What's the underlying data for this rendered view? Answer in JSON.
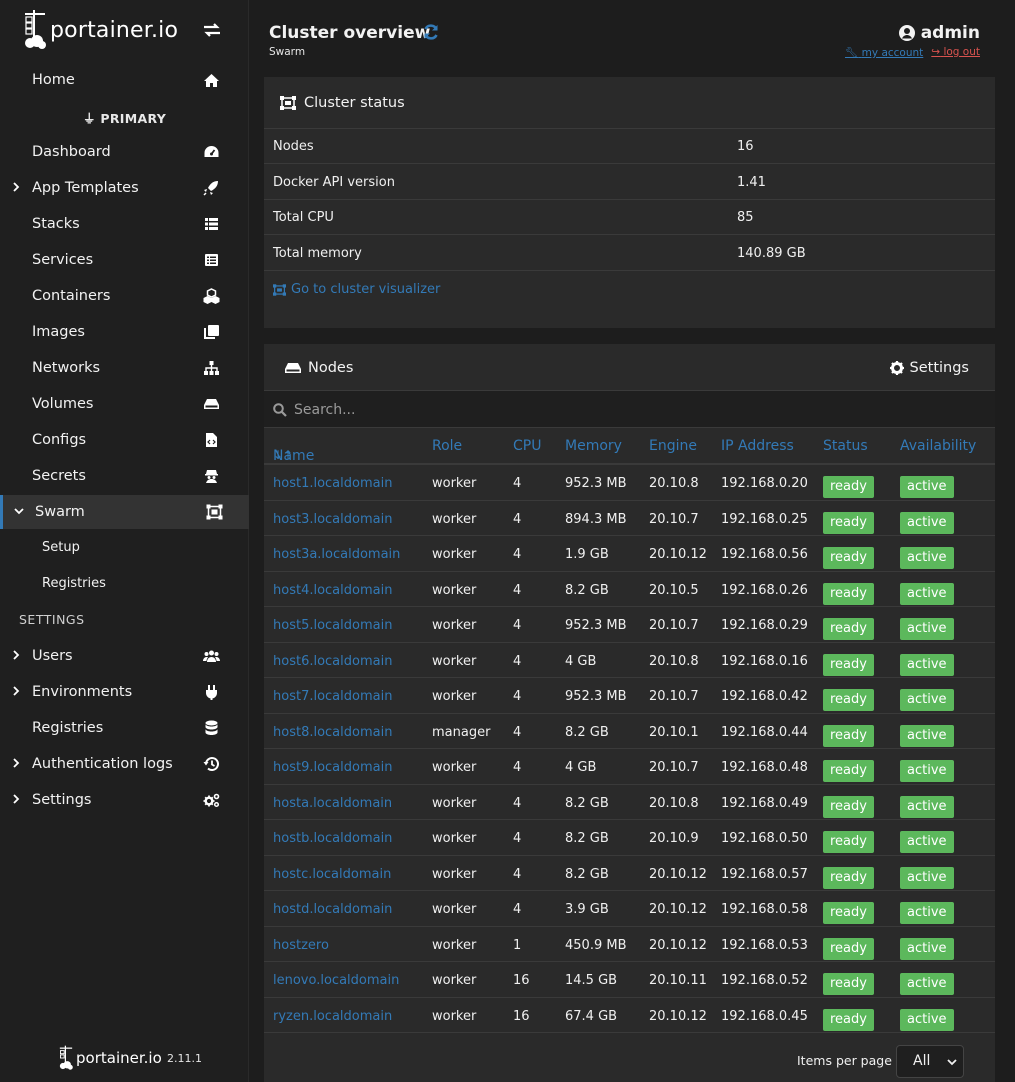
{
  "brand": {
    "name": "portainer.io",
    "version": "2.11.1"
  },
  "sidebar": {
    "home": "Home",
    "environment": "PRIMARY",
    "items": [
      {
        "label": "Dashboard",
        "icon": "dashboard-icon",
        "expandable": false
      },
      {
        "label": "App Templates",
        "icon": "rocket-icon",
        "expandable": true
      },
      {
        "label": "Stacks",
        "icon": "th-list-icon",
        "expandable": false
      },
      {
        "label": "Services",
        "icon": "list-alt-icon",
        "expandable": false
      },
      {
        "label": "Containers",
        "icon": "cubes-icon",
        "expandable": false
      },
      {
        "label": "Images",
        "icon": "clone-icon",
        "expandable": false
      },
      {
        "label": "Networks",
        "icon": "sitemap-icon",
        "expandable": false
      },
      {
        "label": "Volumes",
        "icon": "hdd-icon",
        "expandable": false
      },
      {
        "label": "Configs",
        "icon": "file-code-icon",
        "expandable": false
      },
      {
        "label": "Secrets",
        "icon": "user-secret-icon",
        "expandable": false
      },
      {
        "label": "Swarm",
        "icon": "object-group-icon",
        "expandable": true,
        "active": true
      }
    ],
    "swarm_sub": [
      "Setup",
      "Registries"
    ],
    "settings_title": "SETTINGS",
    "settings_items": [
      {
        "label": "Users",
        "icon": "users-icon",
        "expandable": true
      },
      {
        "label": "Environments",
        "icon": "plug-icon",
        "expandable": true
      },
      {
        "label": "Registries",
        "icon": "database-icon",
        "expandable": false
      },
      {
        "label": "Authentication logs",
        "icon": "history-icon",
        "expandable": true
      },
      {
        "label": "Settings",
        "icon": "cogs-icon",
        "expandable": true
      }
    ]
  },
  "header": {
    "title": "Cluster overview",
    "breadcrumb": "Swarm",
    "user": "admin",
    "my_account": "my account",
    "log_out": "log out"
  },
  "cluster_status": {
    "title": "Cluster status",
    "rows": [
      {
        "key": "Nodes",
        "value": "16"
      },
      {
        "key": "Docker API version",
        "value": "1.41"
      },
      {
        "key": "Total CPU",
        "value": "85"
      },
      {
        "key": "Total memory",
        "value": "140.89 GB"
      }
    ],
    "visualizer_link": "Go to cluster visualizer"
  },
  "nodes": {
    "title": "Nodes",
    "settings_label": "Settings",
    "search_placeholder": "Search...",
    "columns": [
      "Name",
      "Role",
      "CPU",
      "Memory",
      "Engine",
      "IP Address",
      "Status",
      "Availability"
    ],
    "rows": [
      [
        "host1.localdomain",
        "worker",
        "4",
        "952.3 MB",
        "20.10.8",
        "192.168.0.20",
        "ready",
        "active"
      ],
      [
        "host3.localdomain",
        "worker",
        "4",
        "894.3 MB",
        "20.10.7",
        "192.168.0.25",
        "ready",
        "active"
      ],
      [
        "host3a.localdomain",
        "worker",
        "4",
        "1.9 GB",
        "20.10.12",
        "192.168.0.56",
        "ready",
        "active"
      ],
      [
        "host4.localdomain",
        "worker",
        "4",
        "8.2 GB",
        "20.10.5",
        "192.168.0.26",
        "ready",
        "active"
      ],
      [
        "host5.localdomain",
        "worker",
        "4",
        "952.3 MB",
        "20.10.7",
        "192.168.0.29",
        "ready",
        "active"
      ],
      [
        "host6.localdomain",
        "worker",
        "4",
        "4 GB",
        "20.10.8",
        "192.168.0.16",
        "ready",
        "active"
      ],
      [
        "host7.localdomain",
        "worker",
        "4",
        "952.3 MB",
        "20.10.7",
        "192.168.0.42",
        "ready",
        "active"
      ],
      [
        "host8.localdomain",
        "manager",
        "4",
        "8.2 GB",
        "20.10.1",
        "192.168.0.44",
        "ready",
        "active"
      ],
      [
        "host9.localdomain",
        "worker",
        "4",
        "4 GB",
        "20.10.7",
        "192.168.0.48",
        "ready",
        "active"
      ],
      [
        "hosta.localdomain",
        "worker",
        "4",
        "8.2 GB",
        "20.10.8",
        "192.168.0.49",
        "ready",
        "active"
      ],
      [
        "hostb.localdomain",
        "worker",
        "4",
        "8.2 GB",
        "20.10.9",
        "192.168.0.50",
        "ready",
        "active"
      ],
      [
        "hostc.localdomain",
        "worker",
        "4",
        "8.2 GB",
        "20.10.12",
        "192.168.0.57",
        "ready",
        "active"
      ],
      [
        "hostd.localdomain",
        "worker",
        "4",
        "3.9 GB",
        "20.10.12",
        "192.168.0.58",
        "ready",
        "active"
      ],
      [
        "hostzero",
        "worker",
        "1",
        "450.9 MB",
        "20.10.12",
        "192.168.0.53",
        "ready",
        "active"
      ],
      [
        "lenovo.localdomain",
        "worker",
        "16",
        "14.5 GB",
        "20.10.11",
        "192.168.0.52",
        "ready",
        "active"
      ],
      [
        "ryzen.localdomain",
        "worker",
        "16",
        "67.4 GB",
        "20.10.12",
        "192.168.0.45",
        "ready",
        "active"
      ]
    ],
    "items_per_page_label": "Items per page",
    "items_per_page_value": "All"
  },
  "colors": {
    "accent": "#337ab7",
    "success": "#5cb85c",
    "danger": "#d9534f",
    "sidebar_bg": "#1f1f1f",
    "panel_bg": "#2a2a2a"
  }
}
